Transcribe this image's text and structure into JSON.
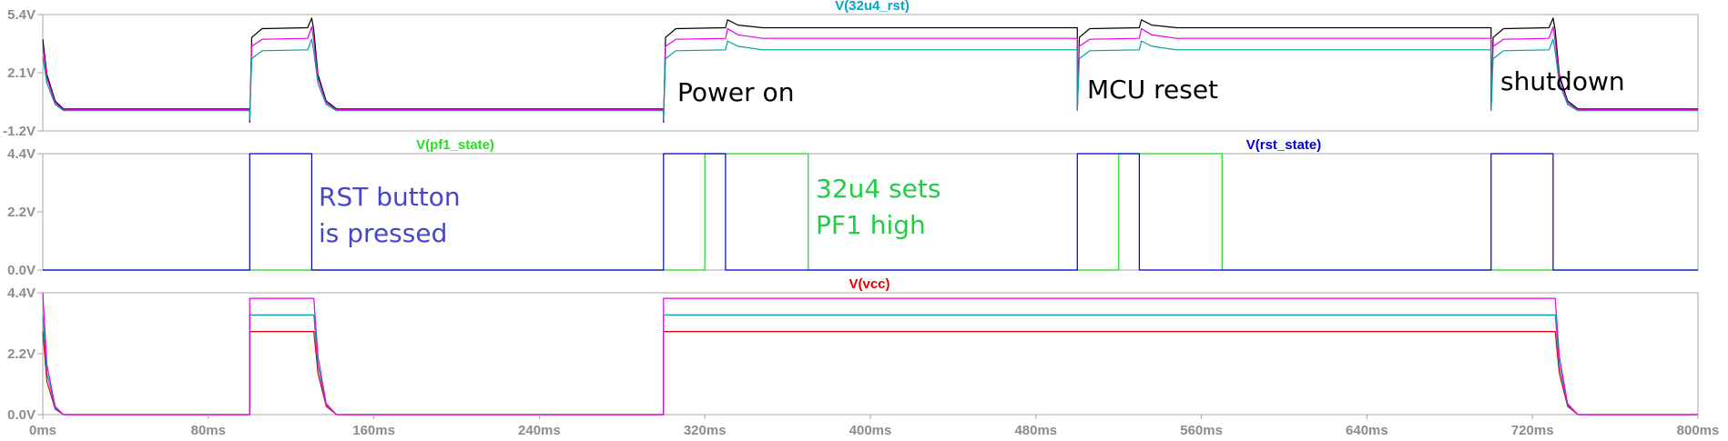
{
  "colors": {
    "frame": "#a6a6a6",
    "tick": "#8c8c8c",
    "black": "#000000",
    "magenta": "#e600e6",
    "teal": "#00a0a0",
    "blue": "#0000cc",
    "green": "#1fd41f",
    "red": "#e00000",
    "title_32u4": "#00a8c8",
    "title_pf1": "#22e022",
    "title_rst": "#0000dd",
    "title_vcc": "#e00000",
    "note_blue": "#4646c8",
    "note_green": "#22cc44"
  },
  "x_ticks": [
    "0ms",
    "80ms",
    "160ms",
    "240ms",
    "320ms",
    "400ms",
    "480ms",
    "560ms",
    "640ms",
    "720ms",
    "800ms"
  ],
  "annotations": {
    "power_on": "Power on",
    "mcu_reset": "MCU reset",
    "shutdown": "shutdown",
    "rst_line1": "RST button",
    "rst_line2": "is pressed",
    "pf1_line1": "32u4 sets",
    "pf1_line2": "PF1 high"
  },
  "chart_data": [
    {
      "type": "line",
      "title": "V(32u4_rst)",
      "xlabel": "",
      "ylabel": "",
      "xlim": [
        0,
        800
      ],
      "ylim": [
        -1.2,
        5.4
      ],
      "yticks": [
        "5.4V",
        "2.1V",
        "-1.2V"
      ],
      "ytick_values": [
        5.4,
        2.1,
        -1.2
      ],
      "grid": false,
      "series": [
        {
          "color": "black",
          "points": [
            [
              0,
              4.0
            ],
            [
              2,
              2.0
            ],
            [
              6,
              0.5
            ],
            [
              10,
              0.05
            ],
            [
              100,
              0.05
            ],
            [
              100,
              -0.7
            ],
            [
              101,
              4.1
            ],
            [
              106,
              4.6
            ],
            [
              128,
              4.65
            ],
            [
              130,
              5.2
            ],
            [
              131,
              4.5
            ],
            [
              133,
              2.0
            ],
            [
              137,
              0.5
            ],
            [
              142,
              0.05
            ],
            [
              300,
              0.05
            ],
            [
              300,
              -0.7
            ],
            [
              301,
              4.1
            ],
            [
              306,
              4.6
            ],
            [
              330,
              4.65
            ],
            [
              331,
              5.1
            ],
            [
              336,
              4.8
            ],
            [
              348,
              4.65
            ],
            [
              500,
              4.65
            ],
            [
              500,
              0.05
            ],
            [
              501,
              4.1
            ],
            [
              506,
              4.6
            ],
            [
              530,
              4.65
            ],
            [
              531,
              5.1
            ],
            [
              536,
              4.8
            ],
            [
              548,
              4.65
            ],
            [
              700,
              4.65
            ],
            [
              700,
              0.05
            ],
            [
              701,
              4.1
            ],
            [
              706,
              4.6
            ],
            [
              728,
              4.65
            ],
            [
              730,
              5.2
            ],
            [
              731,
              4.5
            ],
            [
              733,
              2.0
            ],
            [
              737,
              0.5
            ],
            [
              742,
              0.05
            ],
            [
              800,
              0.05
            ]
          ]
        },
        {
          "color": "magenta",
          "points": [
            [
              0,
              3.6
            ],
            [
              2,
              1.8
            ],
            [
              6,
              0.4
            ],
            [
              10,
              0.0
            ],
            [
              100,
              0.0
            ],
            [
              100,
              -0.6
            ],
            [
              101,
              3.6
            ],
            [
              106,
              4.0
            ],
            [
              128,
              4.05
            ],
            [
              130,
              4.7
            ],
            [
              131,
              3.9
            ],
            [
              133,
              1.8
            ],
            [
              137,
              0.4
            ],
            [
              142,
              0.0
            ],
            [
              300,
              0.0
            ],
            [
              300,
              -0.6
            ],
            [
              301,
              3.6
            ],
            [
              306,
              4.0
            ],
            [
              330,
              4.05
            ],
            [
              331,
              4.6
            ],
            [
              336,
              4.25
            ],
            [
              348,
              4.05
            ],
            [
              500,
              4.05
            ],
            [
              500,
              0.0
            ],
            [
              501,
              3.6
            ],
            [
              506,
              4.0
            ],
            [
              530,
              4.05
            ],
            [
              531,
              4.6
            ],
            [
              536,
              4.25
            ],
            [
              548,
              4.05
            ],
            [
              700,
              4.05
            ],
            [
              700,
              0.0
            ],
            [
              701,
              3.6
            ],
            [
              706,
              4.0
            ],
            [
              728,
              4.05
            ],
            [
              730,
              4.7
            ],
            [
              731,
              3.9
            ],
            [
              733,
              1.8
            ],
            [
              737,
              0.4
            ],
            [
              742,
              0.0
            ],
            [
              800,
              0.0
            ]
          ]
        },
        {
          "color": "teal",
          "points": [
            [
              0,
              3.0
            ],
            [
              2,
              1.5
            ],
            [
              6,
              0.3
            ],
            [
              10,
              -0.05
            ],
            [
              100,
              -0.05
            ],
            [
              100,
              -0.5
            ],
            [
              101,
              2.9
            ],
            [
              106,
              3.35
            ],
            [
              128,
              3.4
            ],
            [
              130,
              4.0
            ],
            [
              131,
              3.3
            ],
            [
              133,
              1.5
            ],
            [
              137,
              0.3
            ],
            [
              142,
              -0.05
            ],
            [
              300,
              -0.05
            ],
            [
              300,
              -0.5
            ],
            [
              301,
              2.9
            ],
            [
              306,
              3.35
            ],
            [
              330,
              3.4
            ],
            [
              331,
              3.9
            ],
            [
              336,
              3.6
            ],
            [
              348,
              3.4
            ],
            [
              500,
              3.4
            ],
            [
              500,
              -0.05
            ],
            [
              501,
              2.9
            ],
            [
              506,
              3.35
            ],
            [
              530,
              3.4
            ],
            [
              531,
              3.9
            ],
            [
              536,
              3.6
            ],
            [
              548,
              3.4
            ],
            [
              700,
              3.4
            ],
            [
              700,
              -0.05
            ],
            [
              701,
              2.9
            ],
            [
              706,
              3.35
            ],
            [
              728,
              3.4
            ],
            [
              730,
              4.0
            ],
            [
              731,
              3.3
            ],
            [
              733,
              1.5
            ],
            [
              737,
              0.3
            ],
            [
              742,
              -0.05
            ],
            [
              800,
              -0.05
            ]
          ]
        }
      ]
    },
    {
      "type": "line",
      "title": "V(pf1_state)",
      "title2": "V(rst_state)",
      "xlabel": "",
      "ylabel": "",
      "xlim": [
        0,
        800
      ],
      "ylim": [
        0,
        4.4
      ],
      "yticks": [
        "4.4V",
        "2.2V",
        "0.0V"
      ],
      "ytick_values": [
        4.4,
        2.2,
        0.0
      ],
      "grid": false,
      "series": [
        {
          "name": "V(pf1_state)",
          "color": "green",
          "points": [
            [
              0,
              0
            ],
            [
              320,
              0
            ],
            [
              320,
              4.4
            ],
            [
              370,
              4.4
            ],
            [
              370,
              0
            ],
            [
              520,
              0
            ],
            [
              520,
              4.4
            ],
            [
              570,
              4.4
            ],
            [
              570,
              0
            ],
            [
              800,
              0
            ]
          ]
        },
        {
          "name": "V(rst_state)",
          "color": "blue",
          "points": [
            [
              0,
              0
            ],
            [
              100,
              0
            ],
            [
              100,
              4.4
            ],
            [
              130,
              4.4
            ],
            [
              130,
              0
            ],
            [
              300,
              0
            ],
            [
              300,
              4.4
            ],
            [
              330,
              4.4
            ],
            [
              330,
              0
            ],
            [
              500,
              0
            ],
            [
              500,
              4.4
            ],
            [
              530,
              4.4
            ],
            [
              530,
              0
            ],
            [
              700,
              0
            ],
            [
              700,
              4.4
            ],
            [
              730,
              4.4
            ],
            [
              730,
              0
            ],
            [
              800,
              0
            ]
          ]
        }
      ]
    },
    {
      "type": "line",
      "title": "V(vcc)",
      "xlabel": "",
      "ylabel": "",
      "xlim": [
        0,
        800
      ],
      "ylim": [
        0,
        4.4
      ],
      "yticks": [
        "4.4V",
        "2.2V",
        "0.0V"
      ],
      "ytick_values": [
        4.4,
        2.2,
        0.0
      ],
      "grid": false,
      "series": [
        {
          "color": "red",
          "points": [
            [
              0,
              3.0
            ],
            [
              2,
              1.2
            ],
            [
              6,
              0.2
            ],
            [
              10,
              0.0
            ],
            [
              100,
              0.0
            ],
            [
              100,
              3.0
            ],
            [
              131,
              3.0
            ],
            [
              133,
              1.5
            ],
            [
              137,
              0.3
            ],
            [
              142,
              0.0
            ],
            [
              300,
              0.0
            ],
            [
              300,
              3.0
            ],
            [
              731,
              3.0
            ],
            [
              733,
              1.5
            ],
            [
              737,
              0.3
            ],
            [
              742,
              0.0
            ],
            [
              800,
              0.0
            ]
          ]
        },
        {
          "color": "teal",
          "points": [
            [
              0,
              3.6
            ],
            [
              2,
              1.5
            ],
            [
              6,
              0.25
            ],
            [
              10,
              0.0
            ],
            [
              100,
              0.0
            ],
            [
              100,
              3.6
            ],
            [
              131,
              3.6
            ],
            [
              133,
              1.8
            ],
            [
              137,
              0.35
            ],
            [
              142,
              0.0
            ],
            [
              300,
              0.0
            ],
            [
              300,
              3.6
            ],
            [
              731,
              3.6
            ],
            [
              733,
              1.8
            ],
            [
              737,
              0.35
            ],
            [
              742,
              0.0
            ],
            [
              800,
              0.0
            ]
          ]
        },
        {
          "color": "magenta",
          "points": [
            [
              0,
              4.4
            ],
            [
              2,
              1.8
            ],
            [
              6,
              0.3
            ],
            [
              10,
              0.0
            ],
            [
              100,
              0.0
            ],
            [
              100,
              4.2
            ],
            [
              131,
              4.2
            ],
            [
              133,
              2.1
            ],
            [
              137,
              0.4
            ],
            [
              142,
              0.0
            ],
            [
              300,
              0.0
            ],
            [
              300,
              4.2
            ],
            [
              731,
              4.2
            ],
            [
              733,
              2.1
            ],
            [
              737,
              0.4
            ],
            [
              742,
              0.0
            ],
            [
              800,
              0.0
            ]
          ]
        }
      ]
    }
  ]
}
